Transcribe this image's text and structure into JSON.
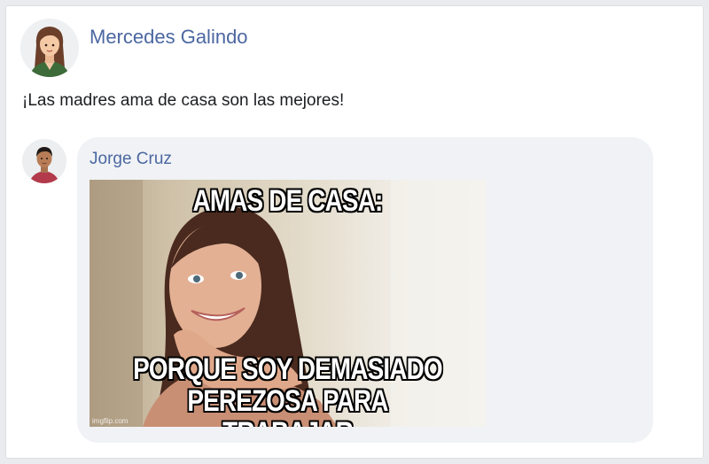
{
  "post": {
    "author": "Mercedes Galindo",
    "text": "¡Las madres ama de casa son las mejores!"
  },
  "comment": {
    "author": "Jorge Cruz",
    "meme": {
      "top_text": "AMAS DE CASA:",
      "bottom_line1": "PORQUE SOY DEMASIADO",
      "bottom_line2": "PEREZOSA PARA TRABAJAR",
      "watermark": "imgflip.com"
    }
  },
  "colors": {
    "link": "#4b67a1",
    "bubble": "#f0f2f5",
    "page_background": "#e9ebee"
  },
  "icons": {
    "post_avatar": "woman-avatar-icon",
    "comment_avatar": "man-avatar-icon"
  }
}
